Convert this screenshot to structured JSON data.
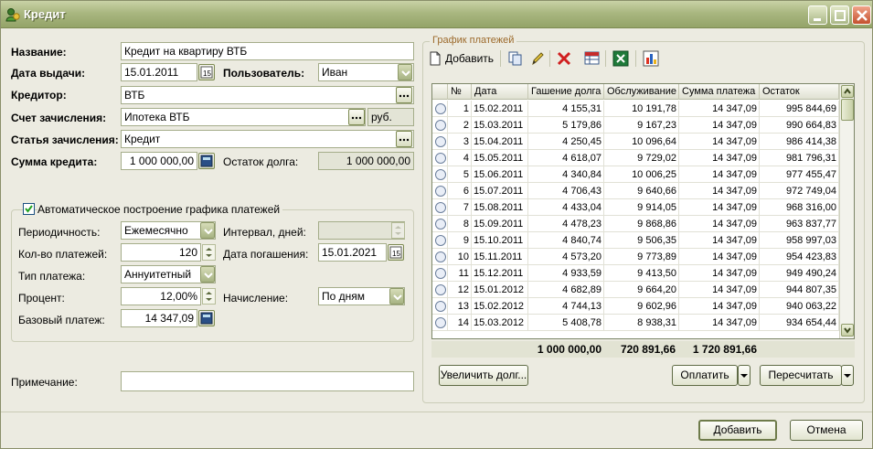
{
  "window": {
    "title": "Кредит"
  },
  "form": {
    "name_label": "Название:",
    "name_value": "Кредит на квартиру ВТБ",
    "date_label": "Дата выдачи:",
    "date_value": "15.01.2011",
    "user_label": "Пользователь:",
    "user_value": "Иван",
    "creditor_label": "Кредитор:",
    "creditor_value": "ВТБ",
    "account_label": "Счет зачисления:",
    "account_value": "Ипотека ВТБ",
    "account_currency": "руб.",
    "article_label": "Статья зачисления:",
    "article_value": "Кредит",
    "amount_label": "Сумма кредита:",
    "amount_value": "1 000 000,00",
    "remaining_label": "Остаток долга:",
    "remaining_value": "1 000 000,00",
    "auto_label": "Автоматическое построение графика платежей",
    "period_label": "Периодичность:",
    "period_value": "Ежемесячно",
    "interval_label": "Интервал, дней:",
    "interval_value": "",
    "count_label": "Кол-во платежей:",
    "count_value": "120",
    "repay_label": "Дата погашения:",
    "repay_value": "15.01.2021",
    "type_label": "Тип платежа:",
    "type_value": "Аннуитетный",
    "percent_label": "Процент:",
    "percent_value": "12,00%",
    "accrual_label": "Начисление:",
    "accrual_value": "По дням",
    "base_label": "Базовый платеж:",
    "base_value": "14 347,09",
    "note_label": "Примечание:",
    "note_value": ""
  },
  "schedule": {
    "group_title": "График платежей",
    "add_label": "Добавить",
    "columns": [
      "№",
      "Дата",
      "Гашение долга",
      "Обслуживание",
      "Сумма платежа",
      "Остаток"
    ],
    "rows": [
      [
        "1",
        "15.02.2011",
        "4 155,31",
        "10 191,78",
        "14 347,09",
        "995 844,69"
      ],
      [
        "2",
        "15.03.2011",
        "5 179,86",
        "9 167,23",
        "14 347,09",
        "990 664,83"
      ],
      [
        "3",
        "15.04.2011",
        "4 250,45",
        "10 096,64",
        "14 347,09",
        "986 414,38"
      ],
      [
        "4",
        "15.05.2011",
        "4 618,07",
        "9 729,02",
        "14 347,09",
        "981 796,31"
      ],
      [
        "5",
        "15.06.2011",
        "4 340,84",
        "10 006,25",
        "14 347,09",
        "977 455,47"
      ],
      [
        "6",
        "15.07.2011",
        "4 706,43",
        "9 640,66",
        "14 347,09",
        "972 749,04"
      ],
      [
        "7",
        "15.08.2011",
        "4 433,04",
        "9 914,05",
        "14 347,09",
        "968 316,00"
      ],
      [
        "8",
        "15.09.2011",
        "4 478,23",
        "9 868,86",
        "14 347,09",
        "963 837,77"
      ],
      [
        "9",
        "15.10.2011",
        "4 840,74",
        "9 506,35",
        "14 347,09",
        "958 997,03"
      ],
      [
        "10",
        "15.11.2011",
        "4 573,20",
        "9 773,89",
        "14 347,09",
        "954 423,83"
      ],
      [
        "11",
        "15.12.2011",
        "4 933,59",
        "9 413,50",
        "14 347,09",
        "949 490,24"
      ],
      [
        "12",
        "15.01.2012",
        "4 682,89",
        "9 664,20",
        "14 347,09",
        "944 807,35"
      ],
      [
        "13",
        "15.02.2012",
        "4 744,13",
        "9 602,96",
        "14 347,09",
        "940 063,22"
      ],
      [
        "14",
        "15.03.2012",
        "5 408,78",
        "8 938,31",
        "14 347,09",
        "934 654,44"
      ]
    ],
    "totals": {
      "principal": "1 000 000,00",
      "service": "720 891,66",
      "payment": "1 720 891,66"
    },
    "increase_label": "Увеличить долг...",
    "pay_label": "Оплатить",
    "recalc_label": "Пересчитать"
  },
  "dialog": {
    "add_label": "Добавить",
    "cancel_label": "Отмена"
  },
  "colors": {
    "title_bar": "#a9b780",
    "group_title": "#9c6a2c"
  }
}
